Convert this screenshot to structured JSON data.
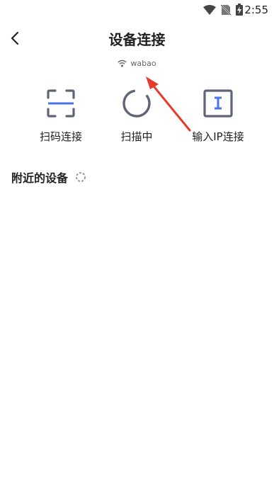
{
  "status_bar": {
    "time": "2:55"
  },
  "header": {
    "title": "设备连接",
    "back_icon": "chevron-left-icon"
  },
  "wifi": {
    "name": "wabao",
    "icon": "wifi-icon"
  },
  "actions": [
    {
      "label": "扫码连接",
      "icon": "scan-frame-icon"
    },
    {
      "label": "扫描中",
      "icon": "loading-ring-icon"
    },
    {
      "label": "输入IP连接",
      "icon": "text-input-icon"
    }
  ],
  "nearby": {
    "title": "附近的设备",
    "icon": "spinner-icon"
  },
  "colors": {
    "accent": "#4a74e8",
    "icon_gray": "#5f6577",
    "arrow": "#e53b2c"
  }
}
